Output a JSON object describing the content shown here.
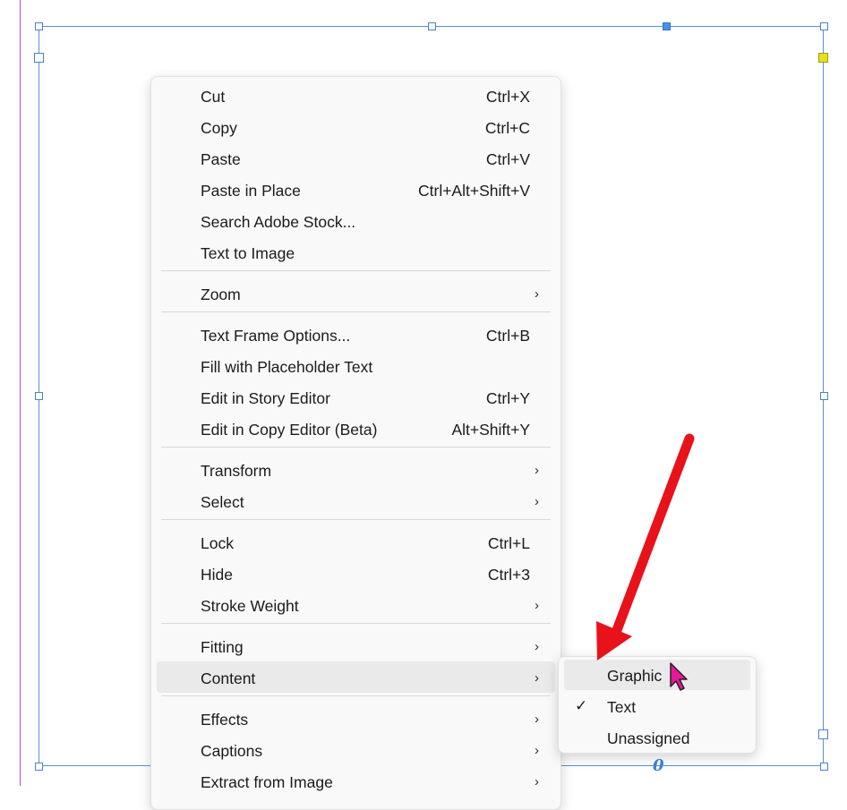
{
  "menu": {
    "items": [
      {
        "label": "Cut",
        "shortcut": "Ctrl+X",
        "submenu": false
      },
      {
        "label": "Copy",
        "shortcut": "Ctrl+C",
        "submenu": false
      },
      {
        "label": "Paste",
        "shortcut": "Ctrl+V",
        "submenu": false
      },
      {
        "label": "Paste in Place",
        "shortcut": "Ctrl+Alt+Shift+V",
        "submenu": false
      },
      {
        "label": "Search Adobe Stock...",
        "shortcut": "",
        "submenu": false
      },
      {
        "label": "Text to Image",
        "shortcut": "",
        "submenu": false
      },
      {
        "label": "Zoom",
        "shortcut": "",
        "submenu": true
      },
      {
        "label": "Text Frame Options...",
        "shortcut": "Ctrl+B",
        "submenu": false
      },
      {
        "label": "Fill with Placeholder Text",
        "shortcut": "",
        "submenu": false
      },
      {
        "label": "Edit in Story Editor",
        "shortcut": "Ctrl+Y",
        "submenu": false
      },
      {
        "label": "Edit in Copy Editor (Beta)",
        "shortcut": "Alt+Shift+Y",
        "submenu": false
      },
      {
        "label": "Transform",
        "shortcut": "",
        "submenu": true
      },
      {
        "label": "Select",
        "shortcut": "",
        "submenu": true
      },
      {
        "label": "Lock",
        "shortcut": "Ctrl+L",
        "submenu": false
      },
      {
        "label": "Hide",
        "shortcut": "Ctrl+3",
        "submenu": false
      },
      {
        "label": "Stroke Weight",
        "shortcut": "",
        "submenu": true
      },
      {
        "label": "Fitting",
        "shortcut": "",
        "submenu": true
      },
      {
        "label": "Content",
        "shortcut": "",
        "submenu": true
      },
      {
        "label": "Effects",
        "shortcut": "",
        "submenu": true
      },
      {
        "label": "Captions",
        "shortcut": "",
        "submenu": true
      },
      {
        "label": "Extract from Image",
        "shortcut": "",
        "submenu": true
      }
    ],
    "chevron": "›"
  },
  "submenu": {
    "items": [
      {
        "label": "Graphic",
        "checked": false
      },
      {
        "label": "Text",
        "checked": true
      },
      {
        "label": "Unassigned",
        "checked": false
      }
    ],
    "checkmark": "✓"
  },
  "overflow_glyph": "0",
  "colors": {
    "frame": "#5a8fd6",
    "margin_guide": "#b44bc8",
    "annotation_arrow": "#e8121b",
    "cursor": "#e8179a"
  },
  "icons": {
    "annotation": "red-arrow-icon",
    "cursor": "mouse-pointer-icon",
    "submenu": "chevron-right-icon",
    "check": "checkmark-icon"
  }
}
